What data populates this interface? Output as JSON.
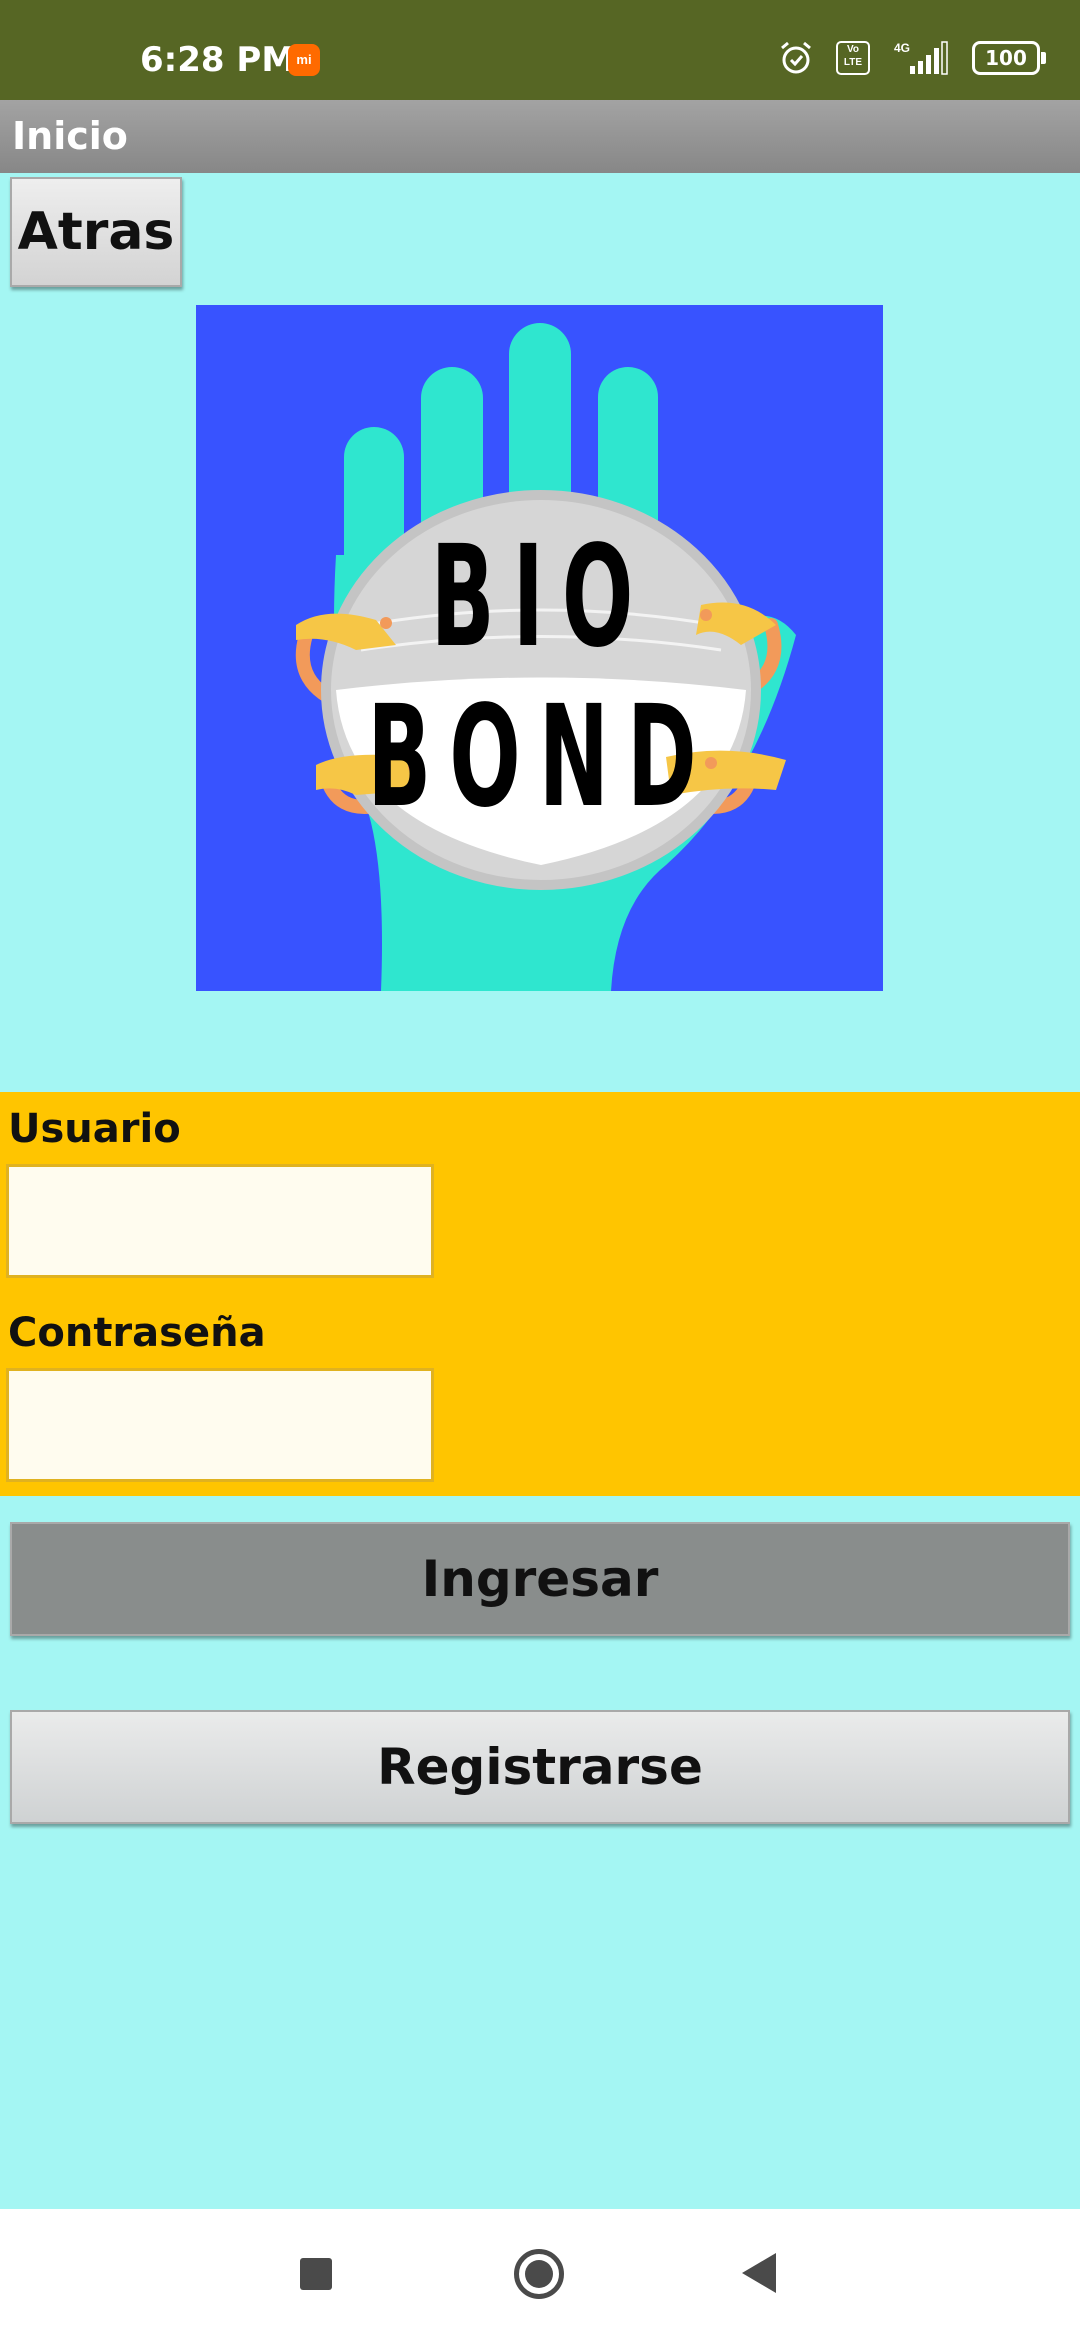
{
  "status_bar": {
    "time": "6:28 PM",
    "notification_icon": "mi-app-icon",
    "icons": [
      "alarm-icon",
      "volte-icon",
      "4g-signal-icon"
    ],
    "volte_label": "Vo LTE",
    "network_label": "4G",
    "battery_level": "100"
  },
  "title_bar": {
    "title": "Inicio"
  },
  "buttons": {
    "back_label": "Atras",
    "login_label": "Ingresar",
    "register_label": "Registrarse"
  },
  "logo": {
    "line1": "BIO",
    "line2": "BOND",
    "colors": {
      "background": "#3853ff",
      "hand": "#2fe6cf",
      "mask": "#d6d6d6",
      "mask_band": "#ffffff",
      "strap": "#f6c646",
      "strap_accent": "#f29a5a"
    }
  },
  "form": {
    "username_label": "Usuario",
    "username_value": "",
    "password_label": "Contraseña",
    "password_value": ""
  },
  "nav_bar": {
    "icons": [
      "recents-square-icon",
      "home-circle-icon",
      "back-triangle-icon"
    ]
  },
  "colors": {
    "status_bar": "#566624",
    "screen_background": "#a4f6f3",
    "form_panel": "#ffc500",
    "login_button": "#898d8c"
  }
}
